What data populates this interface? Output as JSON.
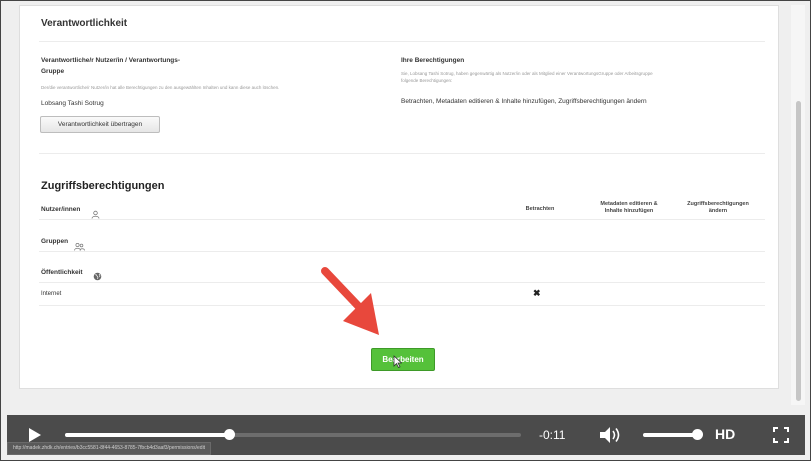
{
  "responsibility": {
    "section_title": "Verantwortlichkeit",
    "owner_heading_line1": "Verantwortliche/r Nutzer/in / Verantwortungs-",
    "owner_heading_line2": "Gruppe",
    "owner_help": "Der/die verantwortliche/r Nutzer/in hat alle Berechtigungen zu den ausgewählten Inhalten und kann diese auch löschen.",
    "owner_name": "Lobsang Tashi Sotrug",
    "transfer_button": "Verantwortlichkeit übertragen",
    "your_perms_heading": "Ihre Berechtigungen",
    "your_perms_help_line1": "Sie, Lobsang Tashi Sotrug, haben gegenwärtig als Nutzer/in oder als Mitglied einer VerantwortungsGruppe oder Arbeitsgruppe",
    "your_perms_help_line2": "folgende Berechtigungen:",
    "your_perms_value": "Betrachten, Metadaten editieren & Inhalte hinzufügen, Zugriffsberechtigungen ändern"
  },
  "access": {
    "section_title": "Zugriffsberechtigungen",
    "users_label": "Nutzer/innen",
    "groups_label": "Gruppen",
    "public_label": "Öffentlichkeit",
    "col_view": "Betrachten",
    "col_meta_line1": "Metadaten editieren &",
    "col_meta_line2": "Inhalte hinzufügen",
    "col_perms_line1": "Zugriffsberechtigungen",
    "col_perms_line2": "ändern",
    "internet_row_label": "Internet",
    "internet_view_mark": "✖"
  },
  "edit_button": "Bearbeiten",
  "video": {
    "time_remaining": "-0:11",
    "hd_label": "HD",
    "progress": 0.36,
    "volume": 0.9,
    "status_url": "http://madek.zhdk.ch/entries/b3cc5581-8f44-4653-8785-7fbcb4d3aaf3/permissions/edit"
  }
}
